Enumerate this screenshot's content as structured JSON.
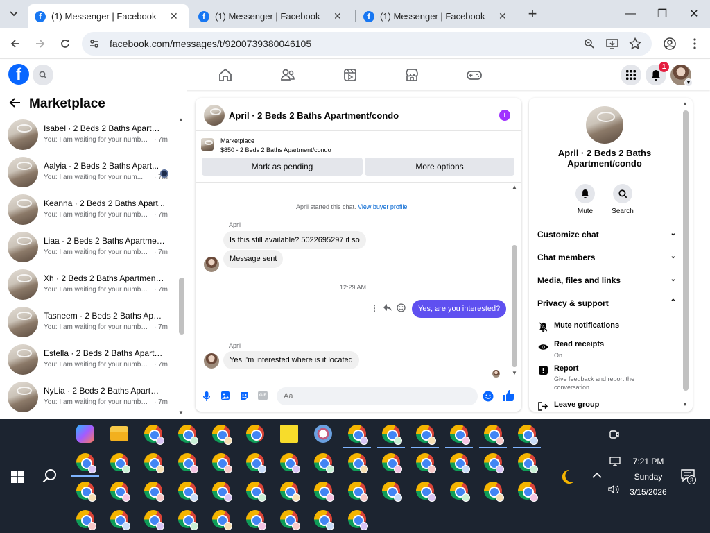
{
  "browser": {
    "tabs": [
      {
        "title": "(1) Messenger | Facebook",
        "active": true
      },
      {
        "title": "(1) Messenger | Facebook",
        "active": false
      },
      {
        "title": "(1) Messenger | Facebook",
        "active": false
      }
    ],
    "url": "facebook.com/messages/t/9200739380046105"
  },
  "fbheader": {
    "notif_count": "1"
  },
  "left": {
    "title": "Marketplace",
    "conversations": [
      {
        "name": "Isabel · 2 Beds 2 Baths Apartme...",
        "preview": "You: I am waiting for your numbe...",
        "time": "· 7m"
      },
      {
        "name": "Aalyia · 2 Beds 2 Baths Apart...",
        "preview": "You: I am waiting for your num...",
        "time": "· 7m"
      },
      {
        "name": "Keanna · 2 Beds 2 Baths Apart...",
        "preview": "You: I am waiting for your numbe...",
        "time": "· 7m"
      },
      {
        "name": "Liaa · 2 Beds 2 Baths Apartment...",
        "preview": "You: I am waiting for your numbe...",
        "time": "· 7m"
      },
      {
        "name": "Xh · 2 Beds 2 Baths Apartment/...",
        "preview": "You: I am waiting for your numbe...",
        "time": "· 7m"
      },
      {
        "name": "Tasneem · 2 Beds 2 Baths Apart...",
        "preview": "You: I am waiting for your numbe...",
        "time": "· 7m"
      },
      {
        "name": "Estella · 2 Beds 2 Baths Apartm...",
        "preview": "You: I am waiting for your numbe...",
        "time": "· 7m"
      },
      {
        "name": "NyLia · 2 Beds 2 Baths Apartme...",
        "preview": "You: I am waiting for your numbe...",
        "time": "· 7m"
      }
    ]
  },
  "chat": {
    "title": "April · 2 Beds 2 Baths Apartment/condo",
    "marketplace_label": "Marketplace",
    "listing": "$850 - 2 Beds 2 Baths Apartment/condo",
    "btn_pending": "Mark as pending",
    "btn_options": "More options",
    "started": "April started this chat.",
    "view_profile": "View buyer profile",
    "sender1": "April",
    "msg1": "Is this still available? 5022695297 if so",
    "msg2": "Message sent",
    "timestamp": "12:29 AM",
    "msg3": "Yes, are you interested?",
    "sender2": "April",
    "msg4": "Yes I'm interested where is it located",
    "input_placeholder": "Aa"
  },
  "right": {
    "title": "April · 2 Beds 2 Baths Apartment/condo",
    "mute": "Mute",
    "search": "Search",
    "sections": [
      "Customize chat",
      "Chat members",
      "Media, files and links",
      "Privacy & support"
    ],
    "mute_notifications": "Mute notifications",
    "read_receipts": "Read receipts",
    "read_receipts_state": "On",
    "report": "Report",
    "report_desc": "Give feedback and report the conversation",
    "leave": "Leave group"
  },
  "taskbar": {
    "time": "7:21 PM",
    "day": "Sunday",
    "date": "3/15/2026",
    "notif_count": "3"
  }
}
